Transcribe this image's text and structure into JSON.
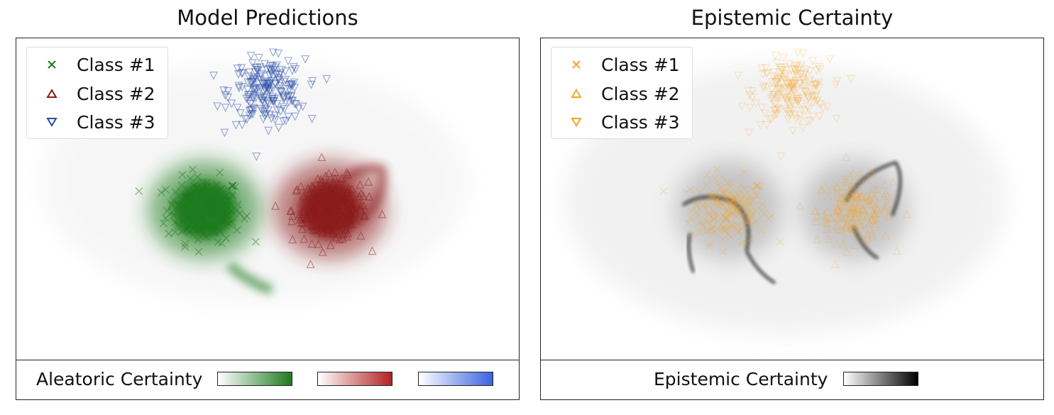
{
  "chart_data": [
    {
      "type": "scatter",
      "title": "Model Predictions",
      "xlim": [
        -4,
        4
      ],
      "ylim": [
        -3,
        3
      ],
      "grid": false,
      "legend_position": "top-left",
      "series": [
        {
          "name": "Class #1",
          "marker": "x",
          "color": "#1e7a1e",
          "center": [
            -1.0,
            -0.2
          ],
          "spread": 0.3,
          "count": 200
        },
        {
          "name": "Class #2",
          "marker": "triangle-up",
          "color": "#8b1a1a",
          "center": [
            1.0,
            -0.2
          ],
          "spread": 0.3,
          "count": 200
        },
        {
          "name": "Class #3",
          "marker": "triangle-down",
          "color": "#2a4da8",
          "center": [
            0.0,
            2.0
          ],
          "spread": 0.3,
          "count": 200
        }
      ],
      "colorbar": {
        "label": "Aleatoric Certainty",
        "gradients": [
          [
            "#ffffff",
            "#1e7a1e"
          ],
          [
            "#ffffff",
            "#b22222"
          ],
          [
            "#ffffff",
            "#3a62e0"
          ]
        ]
      }
    },
    {
      "type": "scatter",
      "title": "Epistemic Certainty",
      "xlim": [
        -4,
        4
      ],
      "ylim": [
        -3,
        3
      ],
      "grid": false,
      "legend_position": "top-left",
      "series": [
        {
          "name": "Class #1",
          "marker": "x",
          "color": "#f5a623"
        },
        {
          "name": "Class #2",
          "marker": "triangle-up",
          "color": "#f5a623"
        },
        {
          "name": "Class #3",
          "marker": "triangle-down",
          "color": "#f5a623"
        }
      ],
      "colorbar": {
        "label": "Epistemic Certainty",
        "gradients": [
          [
            "#ffffff",
            "#000000"
          ]
        ]
      }
    }
  ]
}
